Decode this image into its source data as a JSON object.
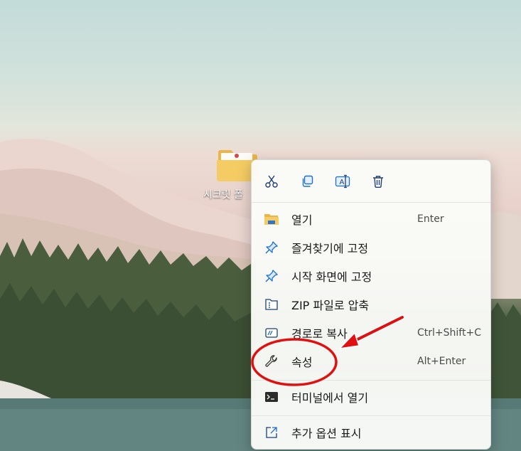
{
  "desktop": {
    "folder_label": "시크릿 폴"
  },
  "context_menu": {
    "toolbar": [
      {
        "name": "cut-icon",
        "tooltip": "잘라내기"
      },
      {
        "name": "copy-icon",
        "tooltip": "복사"
      },
      {
        "name": "rename-icon",
        "tooltip": "이름 바꾸기"
      },
      {
        "name": "delete-icon",
        "tooltip": "삭제"
      }
    ],
    "items": [
      {
        "label": "열기",
        "shortcut": "Enter",
        "icon": "folder-icon"
      },
      {
        "label": "즐겨찾기에 고정",
        "shortcut": "",
        "icon": "pin-icon"
      },
      {
        "label": "시작 화면에 고정",
        "shortcut": "",
        "icon": "pin-icon"
      },
      {
        "label": "ZIP 파일로 압축",
        "shortcut": "",
        "icon": "zip-icon"
      },
      {
        "label": "경로로 복사",
        "shortcut": "Ctrl+Shift+C",
        "icon": "copy-path-icon"
      },
      {
        "label": "속성",
        "shortcut": "Alt+Enter",
        "icon": "wrench-icon"
      },
      {
        "label": "터미널에서 열기",
        "shortcut": "",
        "icon": "terminal-icon"
      },
      {
        "label": "추가 옵션 표시",
        "shortcut": "",
        "icon": "more-options-icon"
      }
    ]
  },
  "annotation": {
    "highlight_color": "#e01010",
    "arrow_color": "#e01010"
  }
}
